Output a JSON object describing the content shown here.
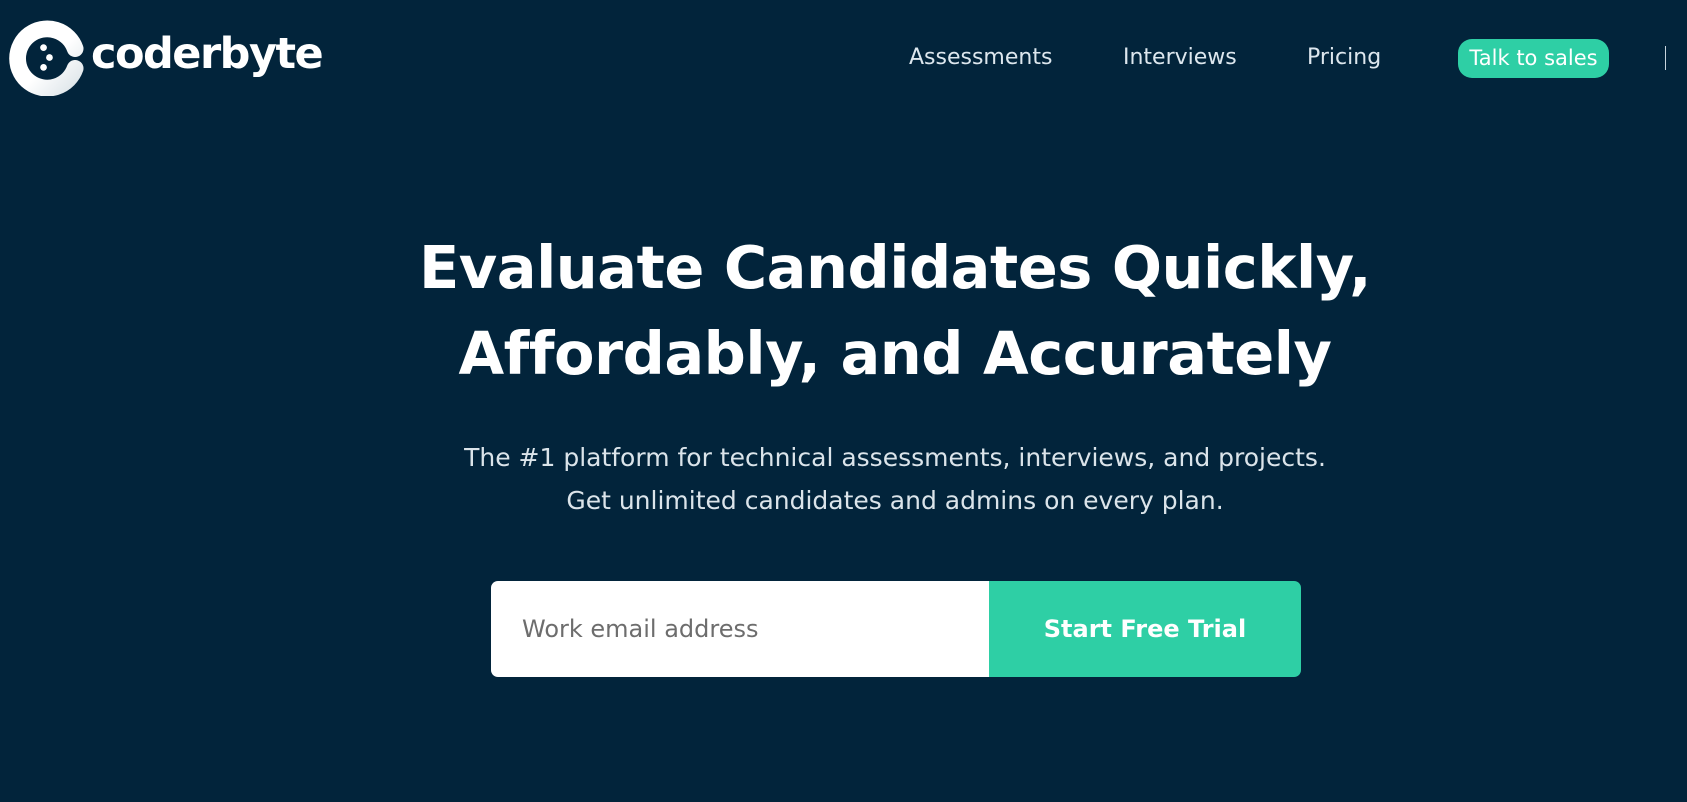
{
  "header": {
    "logo": {
      "text": "coderbyte",
      "icon": "coderbyte-logo-mark"
    },
    "nav": [
      {
        "label": "Assessments"
      },
      {
        "label": "Interviews"
      },
      {
        "label": "Pricing"
      }
    ],
    "cta_label": "Talk to sales",
    "divider_glyph": "|"
  },
  "hero": {
    "title_lines": [
      "Evaluate Candidates Quickly,",
      "Affordably, and Accurately"
    ],
    "subtitle_lines": [
      "The #1 platform for technical assessments, interviews, and projects.",
      "Get unlimited candidates and admins on every plan."
    ]
  },
  "signup": {
    "email_placeholder": "Work email address",
    "email_value": "",
    "button_label": "Start Free Trial"
  },
  "colors": {
    "background": "#02243b",
    "accent": "#2ecfa5",
    "text": "#ffffff",
    "muted_text": "#dbe4ea"
  }
}
